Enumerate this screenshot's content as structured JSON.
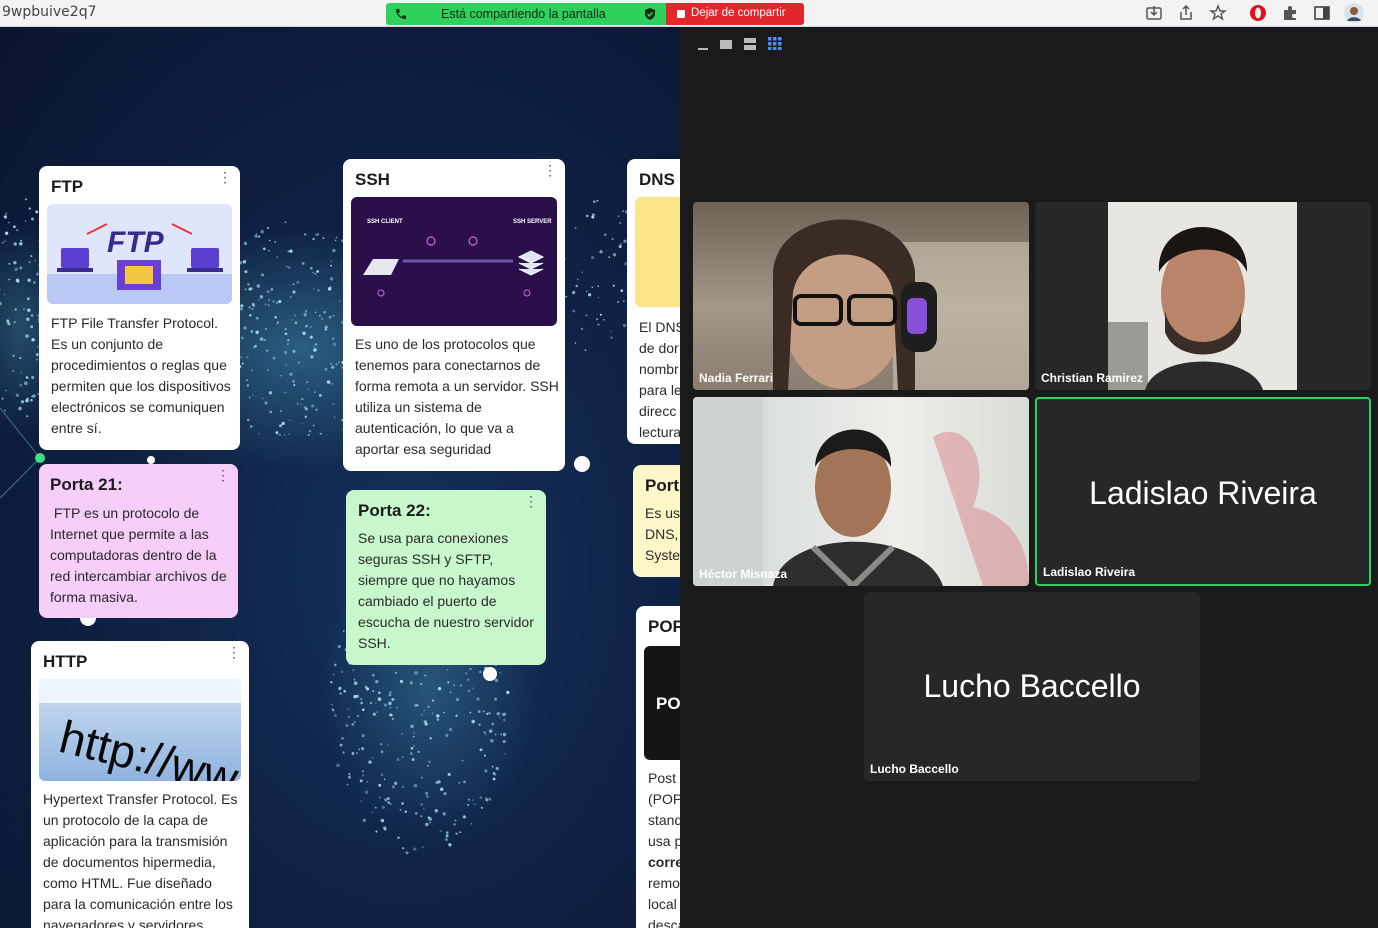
{
  "browser": {
    "url_fragment": "9wpbuive2q7",
    "sharing_status": "Está compartiendo la pantalla",
    "stop_sharing_label": "Dejar de compartir"
  },
  "board": {
    "cards": {
      "ftp": {
        "title": "FTP",
        "image_text": "FTP",
        "body": "FTP File Transfer Protocol. Es un conjunto de procedimientos o reglas que permiten que los dispositivos electrónicos se comuniquen entre sí."
      },
      "ftp_port": {
        "title": "Porta 21:",
        "body": " FTP es un protocolo de Internet que permite a las computadoras dentro de la red intercambiar archivos de forma masiva."
      },
      "http": {
        "title": "HTTP",
        "image_text": "http://ww",
        "body": "Hypertext Transfer Protocol. Es un protocolo de la capa de aplicación para la transmisión de documentos hipermedia, como HTML. Fue diseñado para la comunicación entre los navegadores y servidores"
      },
      "ssh": {
        "title": "SSH",
        "image_labels": {
          "client": "SSH CLIENT",
          "server": "SSH SERVER"
        },
        "body": "Es uno de los protocolos que tenemos para conectarnos de forma remota a un servidor. SSH utiliza un sistema de autenticación, lo que va a aportar esa seguridad"
      },
      "ssh_port": {
        "title": "Porta 22:",
        "body": "Se usa para conexiones seguras SSH y SFTP, siempre que no hayamos cambiado el puerto de escucha de nuestro servidor SSH."
      },
      "dns": {
        "title": "DNS",
        "body_lines": [
          "El DNS",
          "de dor",
          "nombr",
          "para le",
          "direcc",
          "lectura"
        ]
      },
      "dns_port": {
        "title": "Port",
        "body_lines": [
          "Es us",
          "DNS,",
          "Syste"
        ]
      },
      "pop": {
        "title": "POP",
        "image_text": "PO",
        "body_lines": [
          "Post",
          "(POP",
          "stand",
          "usa p",
          "corre",
          "remo",
          "local",
          "descargar los mensajes de"
        ]
      }
    }
  },
  "meeting": {
    "participants": [
      {
        "name": "Nadia Ferrari",
        "video": true
      },
      {
        "name": "Christian Ramirez",
        "video": true
      },
      {
        "name": "Héctor Misnaza",
        "video": true
      },
      {
        "name": "Ladislao Riveira",
        "video": false,
        "active_speaker": true
      },
      {
        "name": "Lucho Baccello",
        "video": false
      }
    ],
    "colors": {
      "active_border": "#2ed15b",
      "panel_bg": "#1a1a1a",
      "tile_bg": "#272727"
    }
  }
}
